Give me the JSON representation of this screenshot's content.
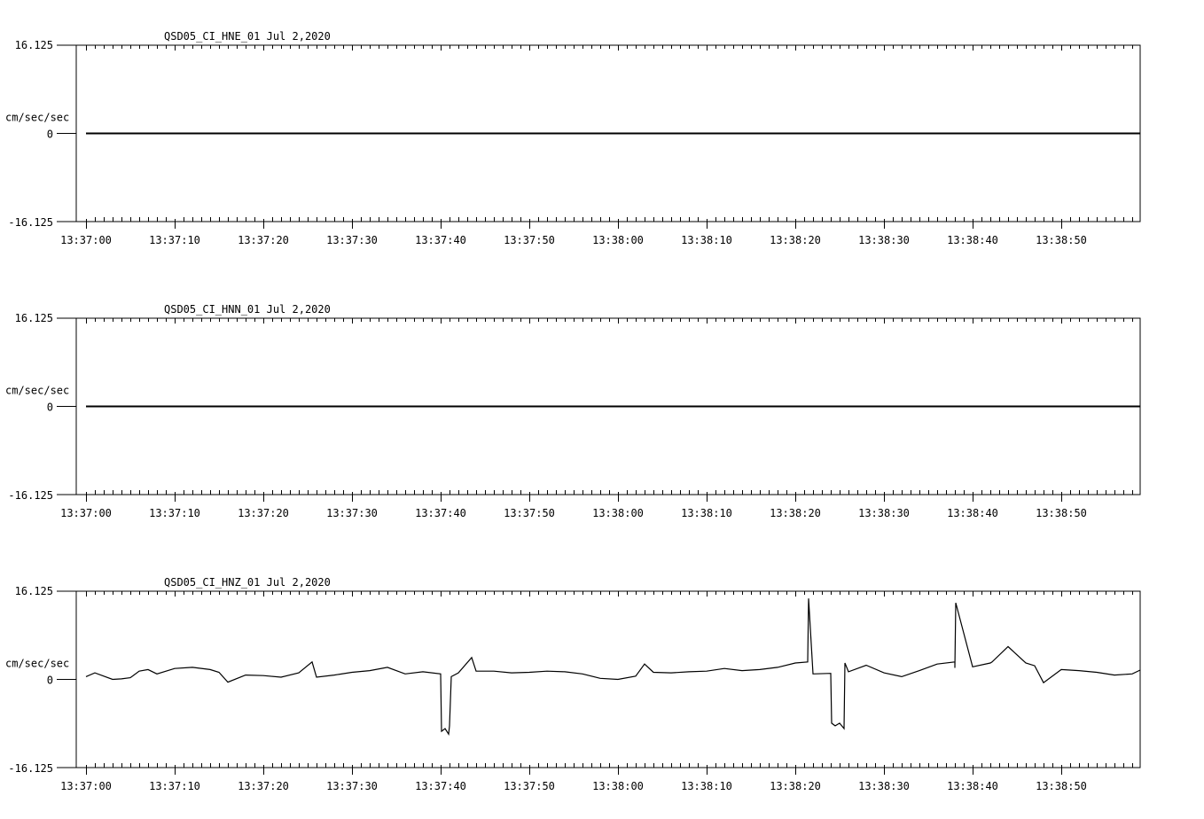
{
  "chart_data": [
    {
      "type": "line",
      "title": "QSD05_CI_HNE_01  Jul 2,2020",
      "ylabel": "cm/sec/sec",
      "ylim": [
        -16.125,
        16.125
      ],
      "yticks": [
        "16.125",
        "0",
        "-16.125"
      ],
      "xticks": [
        "13:37:00",
        "13:37:10",
        "13:37:20",
        "13:37:30",
        "13:37:40",
        "13:37:50",
        "13:38:00",
        "13:38:10",
        "13:38:20",
        "13:38:30",
        "13:38:40",
        "13:38:50"
      ],
      "x_seconds": [
        0,
        3.2,
        3.6,
        118.9
      ],
      "y": [
        0,
        0,
        0,
        0
      ],
      "color": "#000000"
    },
    {
      "type": "line",
      "title": "QSD05_CI_HNN_01  Jul 2,2020",
      "ylabel": "cm/sec/sec",
      "ylim": [
        -16.125,
        16.125
      ],
      "yticks": [
        "16.125",
        "0",
        "-16.125"
      ],
      "xticks": [
        "13:37:00",
        "13:37:10",
        "13:37:20",
        "13:37:30",
        "13:37:40",
        "13:37:50",
        "13:38:00",
        "13:38:10",
        "13:38:20",
        "13:38:30",
        "13:38:40",
        "13:38:50"
      ],
      "x_seconds": [
        0,
        2.8,
        4.4,
        118.9
      ],
      "y": [
        0,
        0,
        0,
        0
      ],
      "color": "#000000"
    },
    {
      "type": "line",
      "title": "QSD05_CI_HNZ_01  Jul 2,2020",
      "ylabel": "cm/sec/sec",
      "ylim": [
        -16.125,
        16.125
      ],
      "yticks": [
        "16.125",
        "0",
        "-16.125"
      ],
      "xticks": [
        "13:37:00",
        "13:37:10",
        "13:37:20",
        "13:37:30",
        "13:37:40",
        "13:37:50",
        "13:38:00",
        "13:38:10",
        "13:38:20",
        "13:38:30",
        "13:38:40",
        "13:38:50"
      ],
      "x_seconds": [
        0,
        1,
        2,
        3,
        4,
        5,
        6,
        7,
        8,
        10,
        12,
        14,
        15,
        16,
        18,
        20,
        22,
        24,
        25.5,
        26,
        28,
        30,
        32,
        34,
        36,
        38,
        40,
        40.1,
        40.5,
        40.9,
        41,
        41.2,
        42,
        43.5,
        44,
        46,
        48,
        50,
        52,
        54,
        56,
        58,
        60,
        62,
        63,
        64,
        66,
        68,
        70,
        72,
        74,
        76,
        78,
        80,
        81.4,
        81.5,
        82,
        84,
        84.1,
        84.5,
        85,
        85.5,
        85.6,
        86,
        88,
        90,
        92,
        94,
        96,
        98,
        98,
        98.1,
        100,
        102,
        102.2,
        104,
        106,
        107,
        108,
        110,
        112,
        114,
        116,
        118,
        118.9
      ],
      "y": [
        0.5,
        1.2,
        0.6,
        0,
        0.1,
        0.3,
        1.5,
        1.8,
        1.0,
        2.0,
        2.2,
        1.8,
        1.3,
        -0.5,
        0.8,
        0.7,
        0.4,
        1.2,
        3.2,
        0.4,
        0.8,
        1.3,
        1.6,
        2.2,
        1.0,
        1.4,
        1.0,
        -9.5,
        -9.0,
        -10.0,
        -8.5,
        0.5,
        1.2,
        4.0,
        1.5,
        1.5,
        1.2,
        1.3,
        1.5,
        1.4,
        1.0,
        0.2,
        0,
        0.6,
        2.8,
        1.3,
        1.2,
        1.4,
        1.5,
        2.0,
        1.6,
        1.8,
        2.2,
        3.0,
        3.2,
        14.8,
        1.0,
        1.1,
        -8.0,
        -8.5,
        -8.0,
        -9.0,
        3.0,
        1.4,
        2.6,
        1.2,
        0.5,
        1.6,
        2.8,
        3.2,
        2.1,
        14.0,
        2.3,
        3.0,
        3.2,
        6.0,
        3.0,
        2.5,
        -0.6,
        1.8,
        1.6,
        1.3,
        0.8,
        1.0,
        1.7,
        1.3
      ],
      "color": "#000000"
    }
  ]
}
